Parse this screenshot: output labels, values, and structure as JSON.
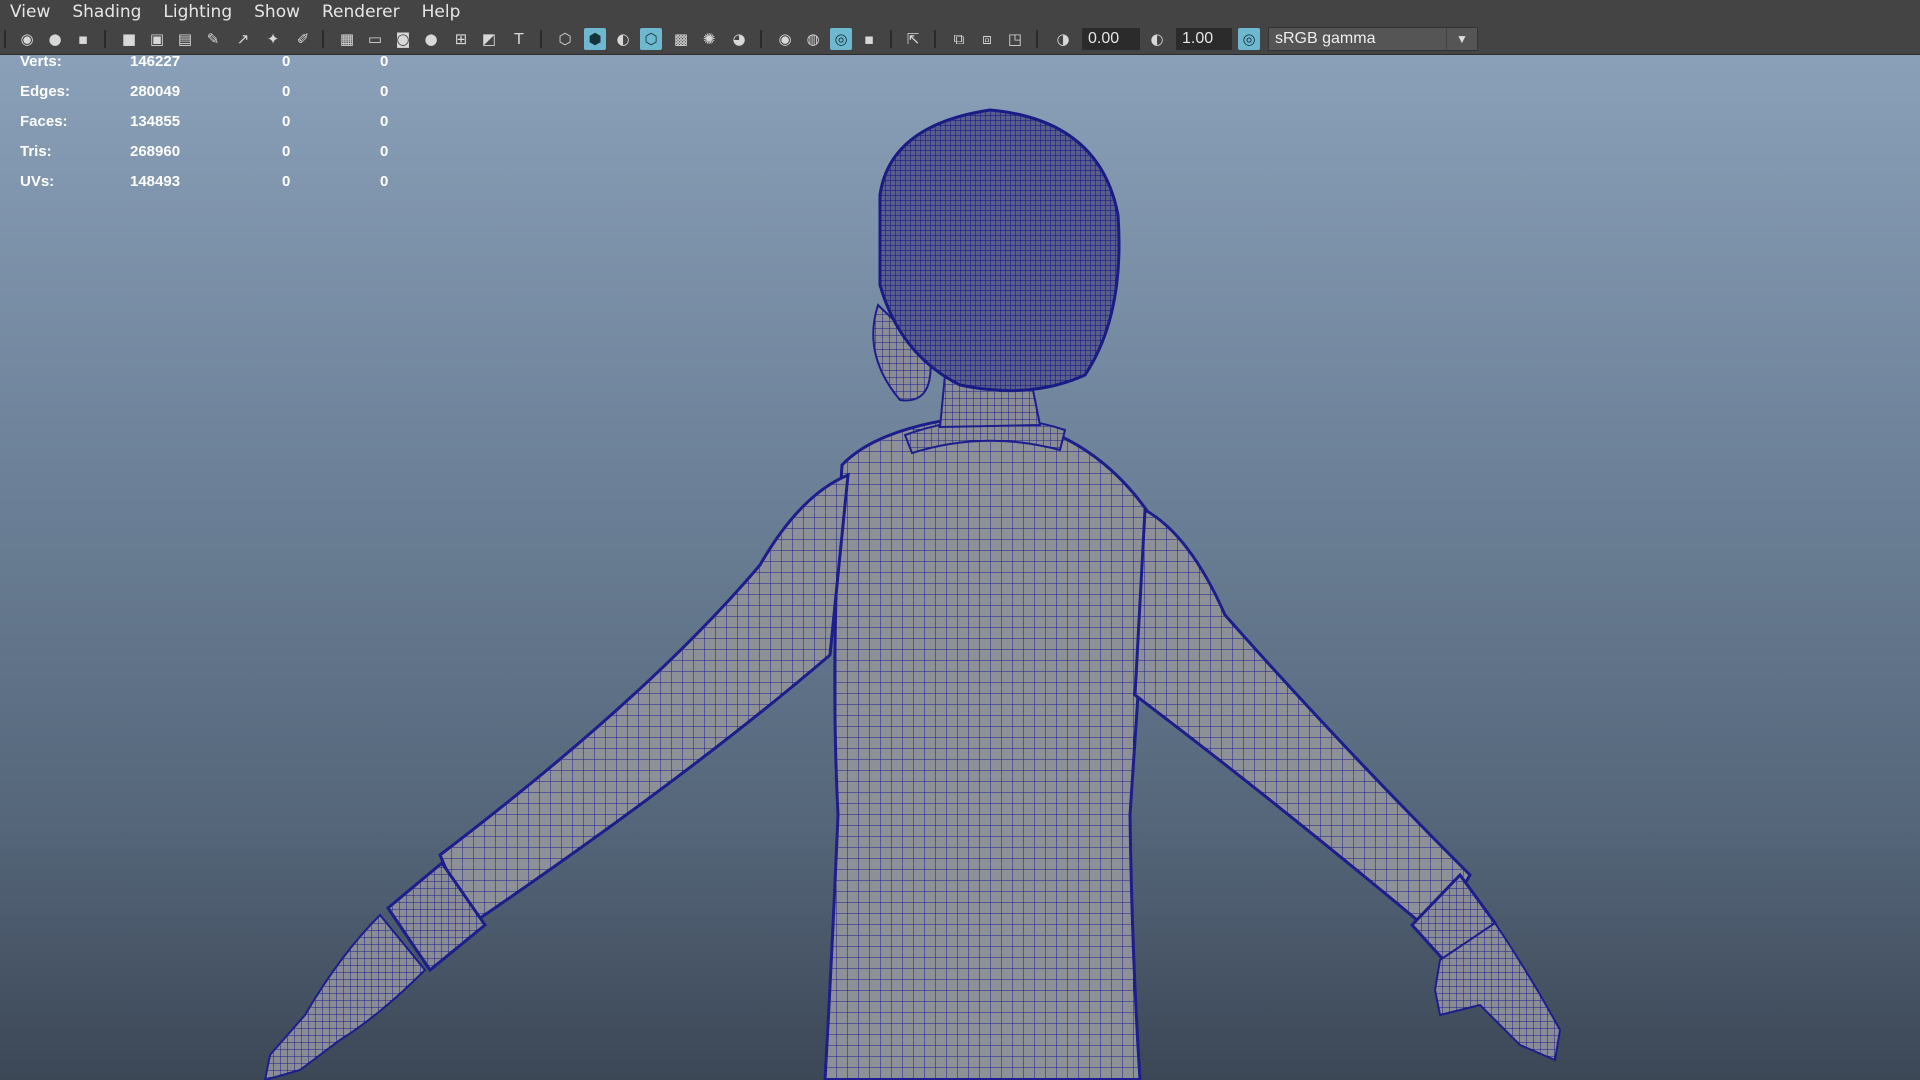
{
  "menubar": {
    "items": [
      "View",
      "Shading",
      "Lighting",
      "Show",
      "Renderer",
      "Help"
    ]
  },
  "toolbar": {
    "exposure_value": "0.00",
    "gamma_value": "1.00",
    "color_space": "sRGB gamma",
    "icons": [
      "select-camera-icon",
      "camera-attributes-icon",
      "bookmark-icon",
      "camera-icon",
      "image-plane-icon",
      "2d-pan-zoom-icon",
      "grease-pencil-icon",
      "grid-icon",
      "film-gate-icon",
      "resolution-gate-icon",
      "gate-mask-icon",
      "field-chart-icon",
      "safe-action-icon",
      "safe-title-icon",
      "wireframe-icon",
      "smooth-shade-icon",
      "use-default-material-icon",
      "wireframe-on-shaded-icon",
      "textured-icon",
      "use-all-lights-icon",
      "shadows-icon",
      "screen-space-ao-icon",
      "motion-blur-icon",
      "anti-aliasing-icon",
      "depth-of-field-icon",
      "isolate-select-icon",
      "xray-icon",
      "xray-active-components-icon",
      "xray-joints-icon",
      "exposure-icon",
      "gamma-icon",
      "color-management-icon"
    ],
    "colors": {
      "bar": "#444444",
      "active": "#6eb9d0"
    }
  },
  "hud": {
    "rows": [
      {
        "label": "Verts:",
        "total": "146227",
        "selected": "0",
        "components": "0"
      },
      {
        "label": "Edges:",
        "total": "280049",
        "selected": "0",
        "components": "0"
      },
      {
        "label": "Faces:",
        "total": "134855",
        "selected": "0",
        "components": "0"
      },
      {
        "label": "Tris:",
        "total": "268960",
        "selected": "0",
        "components": "0"
      },
      {
        "label": "UVs:",
        "total": "148493",
        "selected": "0",
        "components": "0"
      }
    ]
  },
  "viewport": {
    "wire_color": "#1c1e8c",
    "mesh_color": "#8e9098",
    "background_top": "#8aa0b8",
    "background_bottom": "#3c4756"
  }
}
